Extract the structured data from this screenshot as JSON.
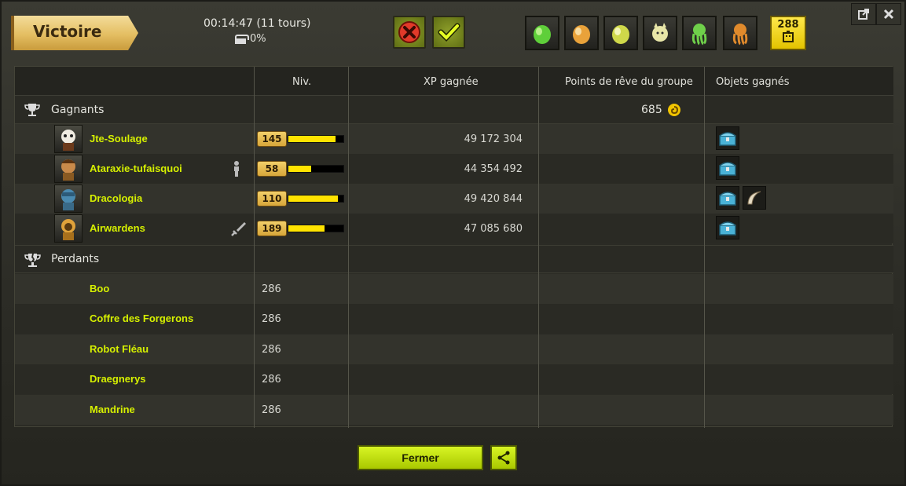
{
  "header": {
    "result": "Victoire",
    "timer": "00:14:47 (11 tours)",
    "chest_percent": "0%",
    "turn_badge": "288"
  },
  "columns": {
    "level": "Niv.",
    "xp": "XP gagnée",
    "dream_points": "Points de rêve du groupe",
    "items": "Objets gagnés"
  },
  "winners": {
    "label": "Gagnants",
    "dream_points": "685",
    "players": [
      {
        "name": "Jte-Soulage",
        "level": "145",
        "level_progress": 0.85,
        "xp": "49 172 304",
        "role_icon": "",
        "items": [
          "chest-icon"
        ]
      },
      {
        "name": "Ataraxie-tufaisquoi",
        "level": "58",
        "level_progress": 0.42,
        "xp": "44 354 492",
        "role_icon": "person-icon",
        "items": [
          "chest-icon"
        ]
      },
      {
        "name": "Dracologia",
        "level": "110",
        "level_progress": 0.9,
        "xp": "49 420 844",
        "role_icon": "",
        "items": [
          "chest-icon",
          "horn-icon"
        ]
      },
      {
        "name": "Airwardens",
        "level": "189",
        "level_progress": 0.65,
        "xp": "47 085 680",
        "role_icon": "sword-icon",
        "items": [
          "chest-icon"
        ]
      }
    ]
  },
  "losers": {
    "label": "Perdants",
    "monsters": [
      {
        "name": "Boo",
        "level": "286"
      },
      {
        "name": "Coffre des Forgerons",
        "level": "286"
      },
      {
        "name": "Robot Fléau",
        "level": "286"
      },
      {
        "name": "Draegnerys",
        "level": "286"
      },
      {
        "name": "Mandrine",
        "level": "286"
      }
    ]
  },
  "footer": {
    "close_label": "Fermer"
  },
  "colors": {
    "name_green": "#d6f000",
    "xp_yellow": "#ffe300",
    "button_green": "#b5d400"
  }
}
